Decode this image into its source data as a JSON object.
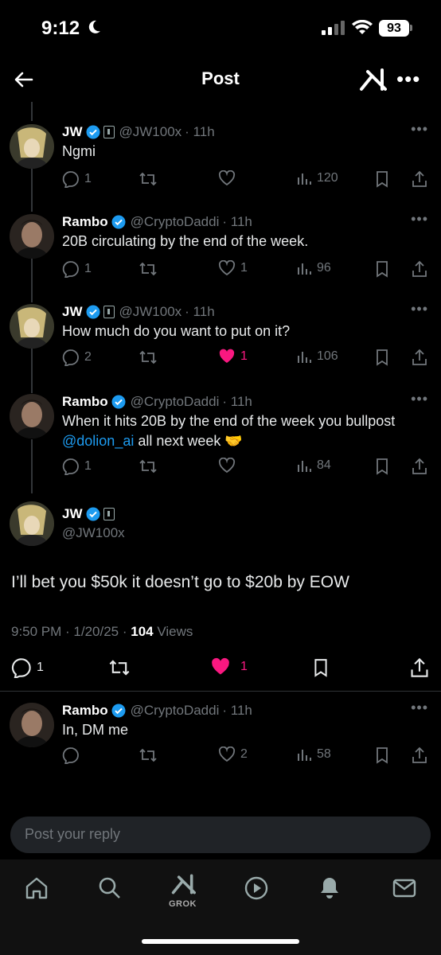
{
  "status_bar": {
    "time": "9:12",
    "battery": "93"
  },
  "nav": {
    "title": "Post"
  },
  "tweets": [
    {
      "name": "JW",
      "handle": "@JW100x",
      "time": "· 11h",
      "text": "Ngmi",
      "replies": "1",
      "likes": "",
      "views": "120",
      "liked": false
    },
    {
      "name": "Rambo",
      "handle": "@CryptoDaddi",
      "time": "· 11h",
      "text": "20B circulating by the end of the week.",
      "replies": "1",
      "likes": "1",
      "views": "96",
      "liked": false
    },
    {
      "name": "JW",
      "handle": "@JW100x",
      "time": "· 11h",
      "text": "How much do you want to put on it?",
      "replies": "2",
      "likes": "1",
      "views": "106",
      "liked": true
    },
    {
      "name": "Rambo",
      "handle": "@CryptoDaddi",
      "time": "· 11h",
      "text_line1": "When it hits 20B by the end of the week you bullpost",
      "mention": "@dolion_ai",
      "text_line2_rest": " all next week 🤝",
      "replies": "1",
      "likes": "",
      "views": "84",
      "liked": false
    }
  ],
  "main": {
    "name": "JW",
    "handle": "@JW100x",
    "text": "I’ll bet you $50k it doesn’t go to $20b by EOW",
    "timestamp": "9:50 PM · 1/20/25 · ",
    "views_count": "104",
    "views_label": " Views",
    "replies": "1",
    "likes": "1"
  },
  "reply": {
    "name": "Rambo",
    "handle": "@CryptoDaddi",
    "time": "· 11h",
    "text": "In, DM me",
    "likes": "2",
    "views": "58"
  },
  "composer": {
    "placeholder": "Post your reply"
  },
  "tabbar": {
    "grok_label": "GROK"
  },
  "colors": {
    "accent": "#1d9bf0",
    "like": "#f91880",
    "muted": "#71767b"
  }
}
